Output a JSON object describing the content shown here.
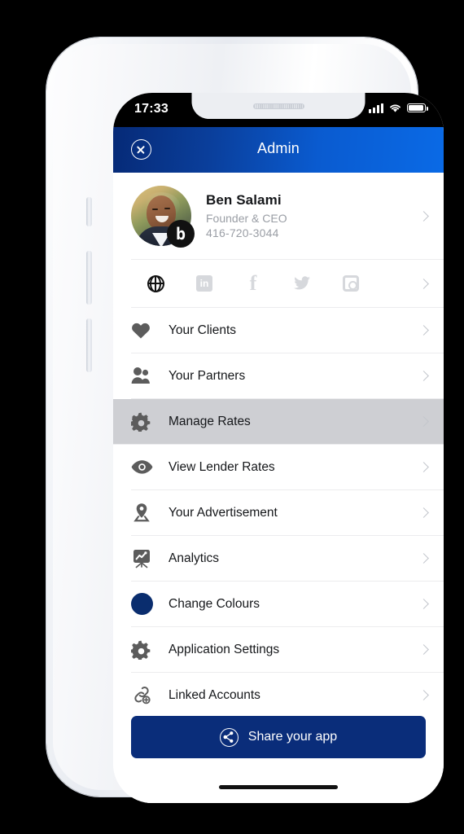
{
  "status_bar": {
    "time": "17:33",
    "signal_icon": "cellular-bars-icon",
    "wifi_icon": "wifi-icon",
    "battery_icon": "battery-icon"
  },
  "header": {
    "title": "Admin",
    "close_icon": "close-circle-icon"
  },
  "profile": {
    "name": "Ben Salami",
    "title": "Founder & CEO",
    "phone": "416-720-3044",
    "badge_logo": "b",
    "avatar_icon": "avatar",
    "chevron_icon": "chevron-right-icon"
  },
  "social": {
    "items": [
      {
        "name": "website-globe-icon",
        "active": true
      },
      {
        "name": "linkedin-icon",
        "label": "in",
        "active": false
      },
      {
        "name": "facebook-icon",
        "label": "f",
        "active": false
      },
      {
        "name": "twitter-icon",
        "label": "ᴛ",
        "active": false
      },
      {
        "name": "instagram-icon",
        "active": false
      }
    ],
    "chevron_icon": "chevron-right-icon"
  },
  "menu": {
    "items": [
      {
        "label": "Your Clients",
        "icon": "heart-icon"
      },
      {
        "label": "Your Partners",
        "icon": "users-icon"
      },
      {
        "label": "Manage Rates",
        "icon": "gear-icon",
        "selected": true
      },
      {
        "label": "View Lender Rates",
        "icon": "eye-icon"
      },
      {
        "label": "Your Advertisement",
        "icon": "map-pin-icon"
      },
      {
        "label": "Analytics",
        "icon": "chart-easel-icon"
      },
      {
        "label": "Change Colours",
        "icon": "colour-swatch-icon"
      },
      {
        "label": "Application Settings",
        "icon": "gear-icon"
      },
      {
        "label": "Linked Accounts",
        "icon": "link-add-icon"
      }
    ]
  },
  "share": {
    "label": "Share your app",
    "icon": "share-icon"
  },
  "colors": {
    "header_gradient_start": "#062a77",
    "header_gradient_end": "#0a6ae6",
    "share_button": "#0a2d7a",
    "selected_row": "#cecfd3",
    "swatch": "#0a2d6e"
  }
}
